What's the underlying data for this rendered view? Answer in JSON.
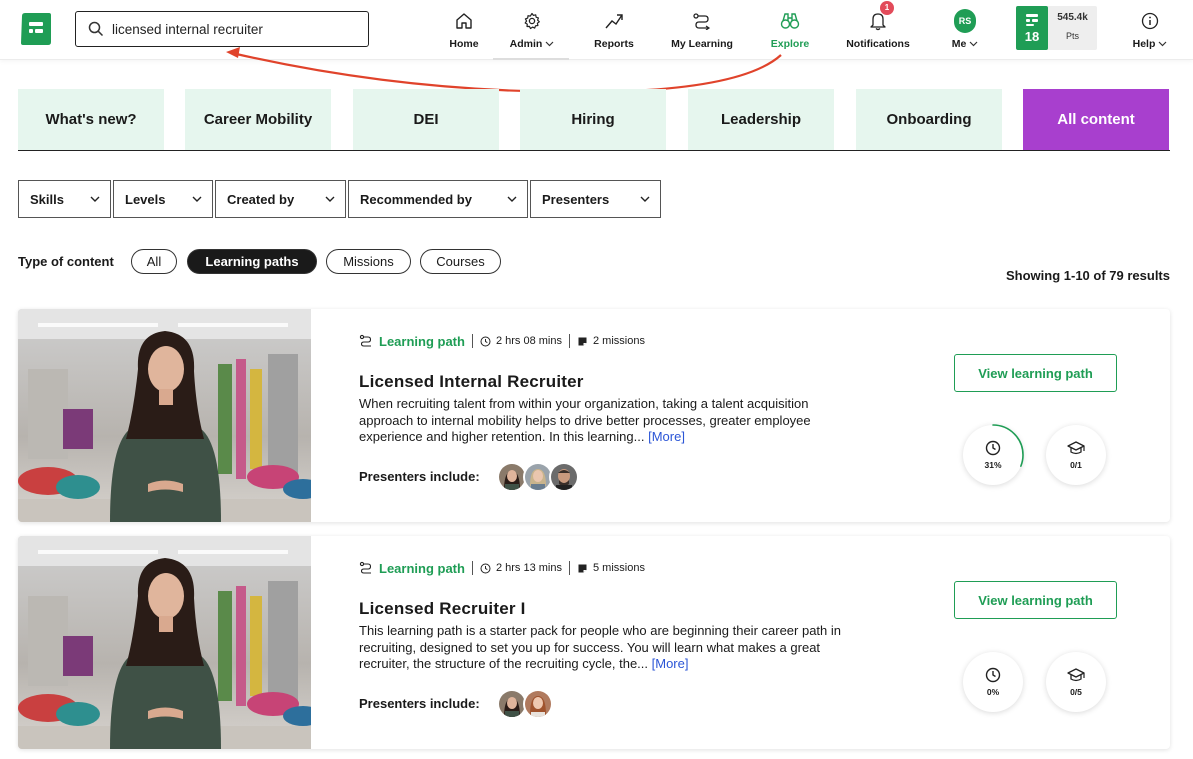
{
  "search": {
    "value": "licensed internal recruiter"
  },
  "nav": [
    {
      "label": "Home",
      "icon": "home-icon"
    },
    {
      "label": "Admin",
      "icon": "gear-icon"
    },
    {
      "label": "Reports",
      "icon": "trend-icon"
    },
    {
      "label": "My Learning",
      "icon": "path-icon"
    },
    {
      "label": "Explore",
      "icon": "binoculars-icon"
    },
    {
      "label": "Notifications",
      "icon": "bell-icon"
    },
    {
      "label": "Me",
      "icon": "avatar"
    },
    {
      "label": "Help",
      "icon": "info-icon"
    }
  ],
  "notifications_count": "1",
  "user_initials": "RS",
  "points": {
    "level": "18",
    "value": "545.4k",
    "label": "Pts"
  },
  "tabs": [
    "What's new?",
    "Career Mobility",
    "DEI",
    "Hiring",
    "Leadership",
    "Onboarding",
    "All content"
  ],
  "active_tab": "All content",
  "filters": [
    "Skills",
    "Levels",
    "Created by",
    "Recommended by",
    "Presenters"
  ],
  "type_of_content": {
    "label": "Type of content",
    "options": [
      "All",
      "Learning paths",
      "Missions",
      "Courses"
    ],
    "selected": "Learning paths"
  },
  "results_text": "Showing 1-10 of 79 results",
  "cards": [
    {
      "type": "Learning path",
      "duration": "2 hrs 08 mins",
      "missions": "2 missions",
      "title": "Licensed Internal Recruiter",
      "description": "When recruiting talent from within your organization, taking a talent acquisition approach to internal mobility helps to drive better processes, greater employee experience and higher retention. In this learning...",
      "more": "[More]",
      "presenters_label": "Presenters include:",
      "presenter_count": 3,
      "button": "View learning path",
      "progress": "31%",
      "progress_fraction": 0.31,
      "completed": "0/1"
    },
    {
      "type": "Learning path",
      "duration": "2 hrs 13 mins",
      "missions": "5 missions",
      "title": "Licensed Recruiter I",
      "description": "This learning path is a starter pack for people who are beginning their career path in recruiting, designed to set you up for success. You will learn what makes a great recruiter, the structure of the recruiting cycle, the...",
      "more": "[More]",
      "presenters_label": "Presenters include:",
      "presenter_count": 2,
      "button": "View learning path",
      "progress": "0%",
      "progress_fraction": 0,
      "completed": "0/5"
    }
  ],
  "colors": {
    "accent": "#1f9d55",
    "tab_bg": "#e6f6ee",
    "active_tab": "#a83fce",
    "arrow": "#e0432b",
    "link": "#2b55d6"
  }
}
